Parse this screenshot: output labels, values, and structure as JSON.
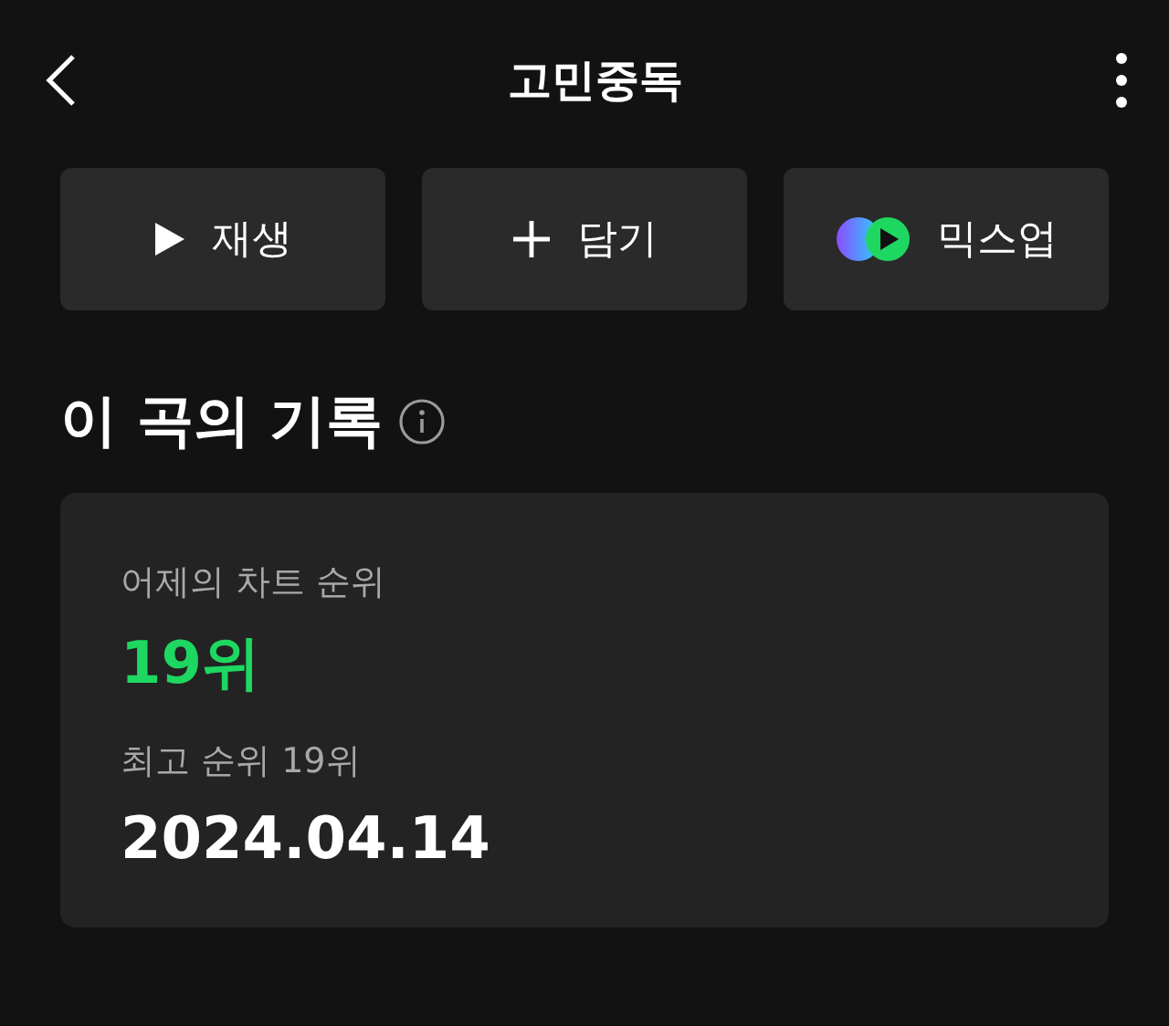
{
  "header": {
    "title": "고민중독"
  },
  "actions": [
    {
      "kind": "play",
      "label": "재생"
    },
    {
      "kind": "add",
      "label": "담기"
    },
    {
      "kind": "mix",
      "label": "믹스업"
    }
  ],
  "section": {
    "title": "이 곡의 기록"
  },
  "record": [
    {
      "kind": "caption",
      "text": "어제의 차트 순위"
    },
    {
      "kind": "rank",
      "text": "19위"
    },
    {
      "kind": "caption",
      "text": "최고 순위 19위"
    },
    {
      "kind": "date",
      "text": "2024.04.14"
    }
  ]
}
